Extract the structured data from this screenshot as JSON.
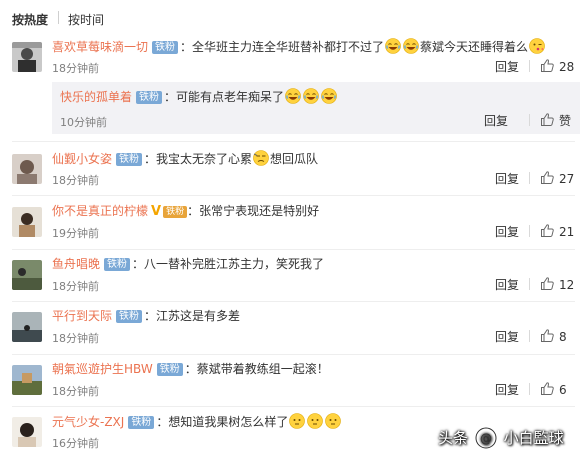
{
  "sort": {
    "hot": "按热度",
    "time": "按时间"
  },
  "colors": {
    "username": "#eb7350",
    "badge": "#7aa8d6",
    "subbox_bg": "#f2f2f5"
  },
  "actions": {
    "reply": "回复",
    "like": "赞"
  },
  "comments": [
    {
      "user": "喜欢草莓味滴一切",
      "badge": "铁粉",
      "text": "：全华班主力连全华班替补都打不过了",
      "tail": "蔡斌今天还睡得着么",
      "time": "18分钟前",
      "likes": "28",
      "reply": {
        "user": "快乐的孤单着",
        "badge": "铁粉",
        "text": "：可能有点老年痴呆了",
        "time": "10分钟前"
      }
    },
    {
      "user": "仙觐小女姿",
      "badge": "铁粉",
      "text": "：我宝太无奈了心累",
      "tail": "想回瓜队",
      "time": "18分钟前",
      "likes": "27"
    },
    {
      "user": "你不是真正的柠檬",
      "badge_v": "V",
      "badge2": "铁粉",
      "text": "：张常宁表现还是特别好",
      "time": "19分钟前",
      "likes": "21"
    },
    {
      "user": "鱼舟唱晚",
      "badge": "铁粉",
      "text": "：八一替补完胜江苏主力，笑死我了",
      "time": "18分钟前",
      "likes": "12"
    },
    {
      "user": "平行到天际",
      "badge": "铁粉",
      "text": "：江苏这是有多差",
      "time": "18分钟前",
      "likes": "8"
    },
    {
      "user": "朝氣巡遊护生HBW",
      "badge": "铁粉",
      "text": "：蔡斌带着教练组一起滚！",
      "time": "18分钟前",
      "likes": "6"
    },
    {
      "user": "元气少女-ZXJ",
      "badge": "铁粉",
      "text": "：想知道我果树怎么样了",
      "time": "16分钟前"
    }
  ],
  "watermark": {
    "prefix": "头条",
    "at": "@",
    "name": "小白監球"
  }
}
